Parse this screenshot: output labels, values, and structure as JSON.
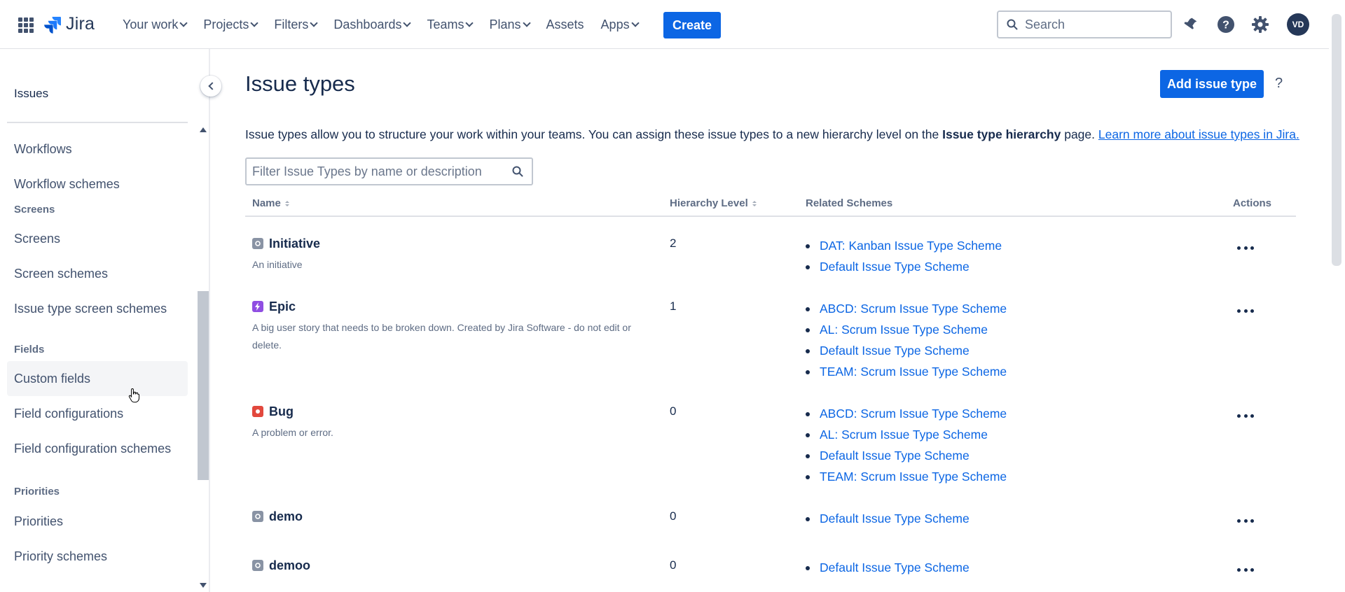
{
  "topnav": {
    "product": "Jira",
    "links": [
      {
        "label": "Your work",
        "dropdown": true
      },
      {
        "label": "Projects",
        "dropdown": true
      },
      {
        "label": "Filters",
        "dropdown": true
      },
      {
        "label": "Dashboards",
        "dropdown": true
      },
      {
        "label": "Teams",
        "dropdown": true
      },
      {
        "label": "Plans",
        "dropdown": true
      },
      {
        "label": "Assets",
        "dropdown": false
      },
      {
        "label": "Apps",
        "dropdown": true
      }
    ],
    "create_label": "Create",
    "search_placeholder": "Search",
    "avatar_initials": "VD",
    "icons": [
      "apps-grid-icon",
      "notifications-icon",
      "help-icon",
      "settings-icon"
    ]
  },
  "sidebar": {
    "title": "Issues",
    "items": [
      {
        "label": "Workflows"
      },
      {
        "label": "Workflow schemes"
      },
      {
        "section": "Screens"
      },
      {
        "label": "Screens"
      },
      {
        "label": "Screen schemes"
      },
      {
        "label": "Issue type screen schemes"
      },
      {
        "section": "Fields"
      },
      {
        "label": "Custom fields",
        "hovered": true
      },
      {
        "label": "Field configurations"
      },
      {
        "label": "Field configuration schemes"
      },
      {
        "section": "Priorities"
      },
      {
        "label": "Priorities"
      },
      {
        "label": "Priority schemes"
      }
    ]
  },
  "main": {
    "title": "Issue types",
    "add_button": "Add issue type",
    "help": "?",
    "description": {
      "before": "Issue types allow you to structure your work within your teams. You can assign these issue types to a new hierarchy level on the ",
      "bold": "Issue type hierarchy",
      "after": " page. ",
      "link": "Learn more about issue types in Jira."
    },
    "filter_placeholder": "Filter Issue Types by name or description",
    "columns": {
      "name": "Name",
      "level": "Hierarchy Level",
      "schemes": "Related Schemes",
      "actions": "Actions"
    },
    "rows": [
      {
        "name": "Initiative",
        "description": "An initiative",
        "level": "2",
        "icon": "initiative-icon",
        "icon_color": "#8993a4",
        "schemes": [
          "DAT: Kanban Issue Type Scheme",
          "Default Issue Type Scheme"
        ]
      },
      {
        "name": "Epic",
        "description": "A big user story that needs to be broken down. Created by Jira Software - do not edit or delete.",
        "level": "1",
        "icon": "epic-icon",
        "icon_color": "#904ee2",
        "schemes": [
          "ABCD: Scrum Issue Type Scheme",
          "AL: Scrum Issue Type Scheme",
          "Default Issue Type Scheme",
          "TEAM: Scrum Issue Type Scheme"
        ]
      },
      {
        "name": "Bug",
        "description": "A problem or error.",
        "level": "0",
        "icon": "bug-icon",
        "icon_color": "#e2483d",
        "schemes": [
          "ABCD: Scrum Issue Type Scheme",
          "AL: Scrum Issue Type Scheme",
          "Default Issue Type Scheme",
          "TEAM: Scrum Issue Type Scheme"
        ]
      },
      {
        "name": "demo",
        "description": "",
        "level": "0",
        "icon": "generic-issue-icon",
        "icon_color": "#8993a4",
        "schemes": [
          "Default Issue Type Scheme"
        ]
      },
      {
        "name": "demoo",
        "description": "",
        "level": "0",
        "icon": "generic-issue-icon",
        "icon_color": "#8993a4",
        "schemes": [
          "Default Issue Type Scheme"
        ]
      }
    ]
  },
  "colors": {
    "primary": "#0c66e4",
    "text": "#172b4d",
    "subtle": "#5e6c84"
  }
}
